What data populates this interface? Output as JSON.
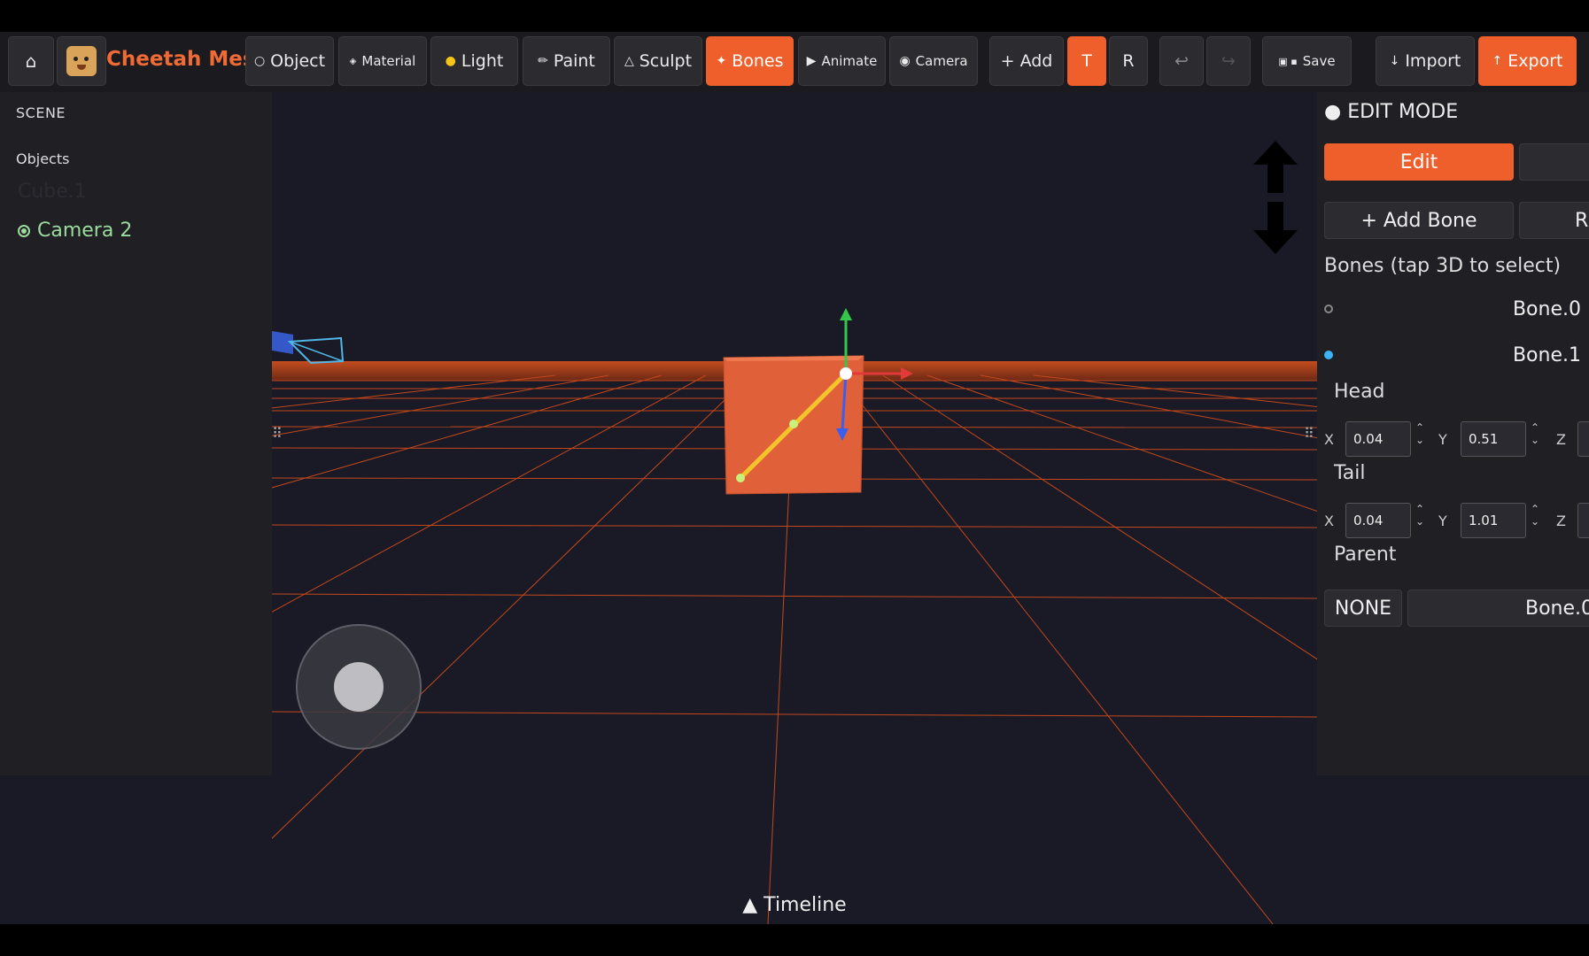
{
  "toolbar": {
    "home_icon": "home-icon",
    "title": "Cheetah Mesh",
    "object": "Object",
    "material": "Material",
    "light": "Light",
    "paint": "Paint",
    "sculpt": "Sculpt",
    "bones": "Bones",
    "animate": "Animate",
    "camera": "Camera",
    "add": "+ Add",
    "t": "T",
    "r": "R",
    "undo": "↩",
    "redo": "↪",
    "save": "Save",
    "import": "Import",
    "export": "Export",
    "accent_color": "#ee5f2c"
  },
  "scene": {
    "header": "SCENE",
    "objects_label": "Objects",
    "items": [
      "Cube.1",
      "Camera 2"
    ]
  },
  "panel": {
    "mode": "● EDIT MODE",
    "edit_button": "Edit",
    "add_bone_button": "+ Add Bone",
    "partial_button": "R",
    "bones_header": "Bones  (tap 3D to select)",
    "bones": [
      "Bone.0",
      "Bone.1"
    ],
    "selected_bone": "Bone.1",
    "head_label": "Head",
    "tail_label": "Tail",
    "head": {
      "x": "0.04",
      "y": "0.51"
    },
    "tail": {
      "x": "0.04",
      "y": "1.01"
    },
    "x_label": "X",
    "y_label": "Y",
    "z_label": "Z",
    "parent_label": "Parent",
    "parent_none": "NONE",
    "parent_bone": "Bone.0"
  },
  "timeline": "▲ Timeline"
}
